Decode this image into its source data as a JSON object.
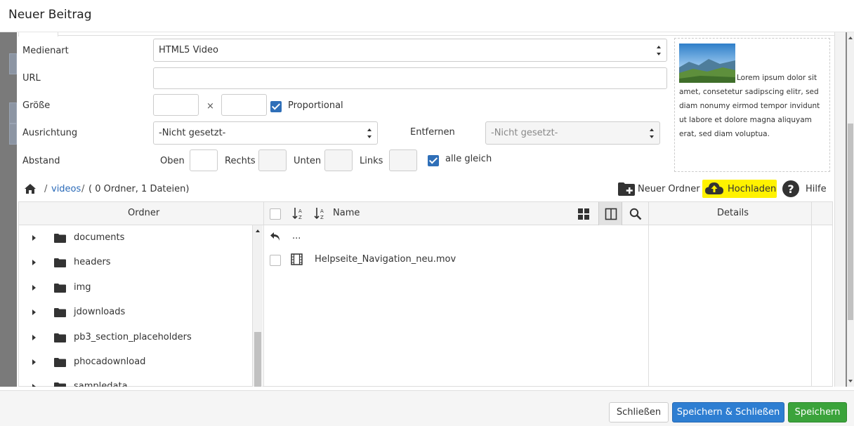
{
  "dialog": {
    "title": "Neuer Beitrag"
  },
  "form": {
    "media_type_label": "Medienart",
    "media_type_value": "HTML5 Video",
    "url_label": "URL",
    "url_value": "",
    "size_label": "Größe",
    "size_times": "×",
    "proportional_label": "Proportional",
    "align_label": "Ausrichtung",
    "align_value": "-Nicht gesetzt-",
    "remove_label": "Entfernen",
    "remove_value": "-Nicht gesetzt-",
    "spacing_label": "Abstand",
    "top_label": "Oben",
    "right_label": "Rechts",
    "bottom_label": "Unten",
    "left_label": "Links",
    "all_same_label": "alle gleich"
  },
  "preview": {
    "text": "Lorem ipsum dolor sit amet, consetetur sadipscing elitr, sed diam nonumy eirmod tempor invidunt ut labore et dolore magna aliquyam erat, sed diam voluptua."
  },
  "breadcrumb": {
    "sep": "/",
    "folder": "videos",
    "info": "( 0 Ordner, 1 Dateien)"
  },
  "toolbar": {
    "new_folder": "Neuer Ordner",
    "upload": "Hochladen",
    "help": "Hilfe"
  },
  "panel": {
    "folders_header": "Ordner",
    "name_header": "Name",
    "details_header": "Details",
    "folders": [
      {
        "name": "documents"
      },
      {
        "name": "headers"
      },
      {
        "name": "img"
      },
      {
        "name": "jdownloads"
      },
      {
        "name": "pb3_section_placeholders"
      },
      {
        "name": "phocadownload"
      },
      {
        "name": "sampledata"
      }
    ],
    "up_label": "...",
    "files": [
      {
        "name": "Helpseite_Navigation_neu.mov"
      }
    ]
  },
  "footer": {
    "close": "Schließen",
    "save_close": "Speichern & Schließen",
    "save": "Speichern"
  },
  "colors": {
    "primary": "#2e7ed2",
    "success": "#3ba33b",
    "highlight": "#fff200",
    "checkbox": "#2f6fb8",
    "link": "#2a6ab8"
  }
}
